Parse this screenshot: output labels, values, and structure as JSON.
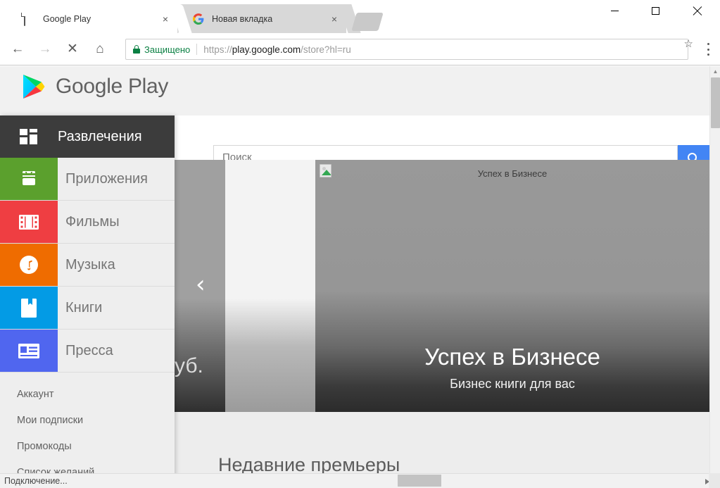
{
  "browser": {
    "tabs": [
      {
        "title": "Google Play",
        "favicon": "document-icon",
        "active": true,
        "close_label": "×"
      },
      {
        "title": "Новая вкладка",
        "favicon": "google-g-icon",
        "active": false,
        "close_label": "×"
      }
    ],
    "new_tab_label": "",
    "window_controls": {
      "minimize": "",
      "maximize": "",
      "close": ""
    },
    "nav": {
      "back": "←",
      "forward": "→",
      "stop": "✕",
      "home": "⌂"
    },
    "omnibox": {
      "security_label": "Защищено",
      "url_scheme": "https://",
      "url_host": "play.google.com",
      "url_path": "/store?hl=ru",
      "bookmark_icon": "☆"
    },
    "status": {
      "text": "Подключение..."
    }
  },
  "page": {
    "brand": {
      "name": "Google Play",
      "logo_colors": {
        "green": "#00d564",
        "blue": "#00c3ff",
        "yellow": "#ffd400",
        "red": "#f6373f"
      }
    },
    "search": {
      "placeholder": "Поиск",
      "value": "",
      "button_icon": "search-icon",
      "button_color": "#4285f4"
    },
    "sidebar": {
      "header": {
        "label": "Развлечения",
        "icon": "tiles-icon",
        "bg": "#3c3c3c"
      },
      "items": [
        {
          "label": "Приложения",
          "icon": "android-icon",
          "color": "#5ba02d"
        },
        {
          "label": "Фильмы",
          "icon": "film-icon",
          "color": "#ef3e42"
        },
        {
          "label": "Музыка",
          "icon": "music-icon",
          "color": "#ef6c00"
        },
        {
          "label": "Книги",
          "icon": "book-icon",
          "color": "#039be5"
        },
        {
          "label": "Пресса",
          "icon": "news-icon",
          "color": "#5066ef"
        }
      ],
      "sub_items": [
        {
          "label": "Аккаунт"
        },
        {
          "label": "Мои подписки"
        },
        {
          "label": "Промокоды"
        },
        {
          "label": "Список желаний"
        }
      ]
    },
    "carousel": {
      "prev_arrow": "‹",
      "partial_left_text": "уб.",
      "slide": {
        "alt_text": "Успех в Бизнесе",
        "title": "Успех в Бизнесе",
        "subtitle": "Бизнес книги для вас",
        "image_state": "broken-image"
      }
    },
    "section": {
      "title": "Недавние премьеры"
    }
  }
}
